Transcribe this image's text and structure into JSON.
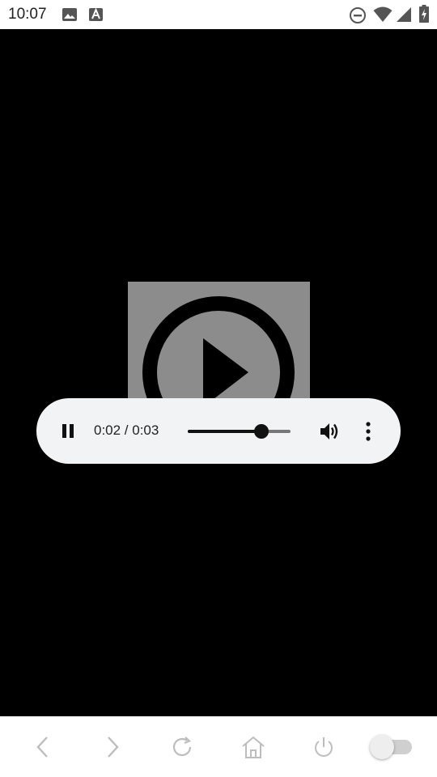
{
  "status_bar": {
    "time": "10:07",
    "icons": [
      "image-icon",
      "text-a-icon",
      "do-not-disturb-icon",
      "wifi-icon",
      "cell-signal-icon",
      "battery-charging-icon"
    ]
  },
  "player": {
    "time_display": "0:02 / 0:03",
    "progress": 0.72,
    "state": "playing",
    "poster_icon": "play-circle-icon"
  },
  "browser_nav": {
    "buttons": [
      "back-icon",
      "forward-icon",
      "reload-icon",
      "home-icon",
      "power-icon"
    ],
    "toggle_on": false
  },
  "colors": {
    "controls_bg": "#f1f3f4",
    "poster_bg": "#8c8c8c",
    "disabled_icon": "#bdbdbd"
  }
}
